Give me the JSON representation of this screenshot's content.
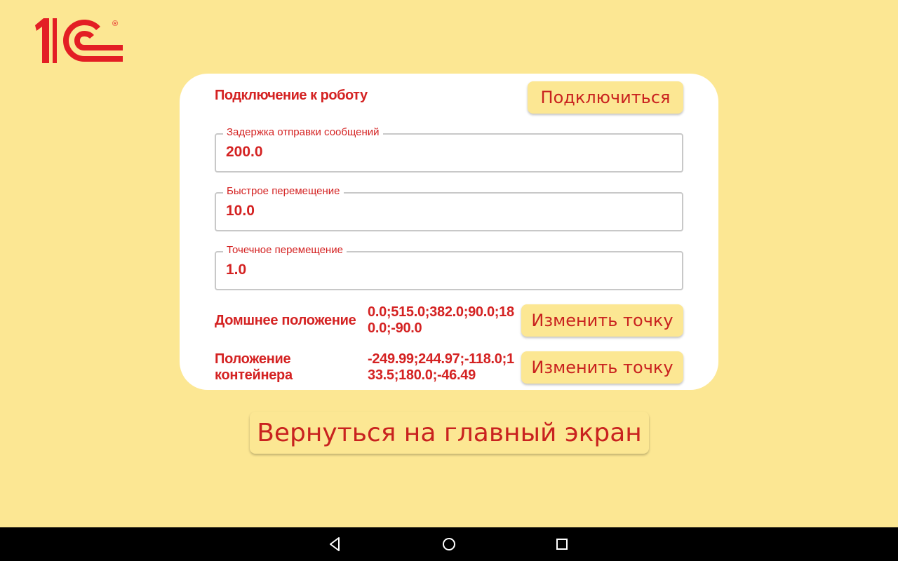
{
  "logo": {
    "text": "1С",
    "reg_mark": "®",
    "color": "#e31e24"
  },
  "card": {
    "title": "Подключение к роботу",
    "connect_label": "Подключиться",
    "fields": [
      {
        "label": "Задержка отправки сообщений",
        "value": "200.0"
      },
      {
        "label": "Быстрое перемещение",
        "value": "10.0"
      },
      {
        "label": "Точечное перемещение",
        "value": "1.0"
      }
    ],
    "positions": [
      {
        "label": "Домшнее положение",
        "value": "0.0;515.0;382.0;90.0;180.0;-90.0",
        "button": "Изменить точку"
      },
      {
        "label": "Положение контейнера",
        "value": "-249.99;244.97;-118.0;133.5;180.0;-46.49",
        "button": "Изменить точку"
      }
    ]
  },
  "home_button_label": "Вернуться на главный экран",
  "navbar": {
    "icons": [
      "back-icon",
      "home-icon",
      "recent-apps-icon"
    ]
  },
  "colors": {
    "background": "#fce793",
    "accent": "#d42222",
    "card": "#ffffff",
    "navbar": "#000000"
  }
}
